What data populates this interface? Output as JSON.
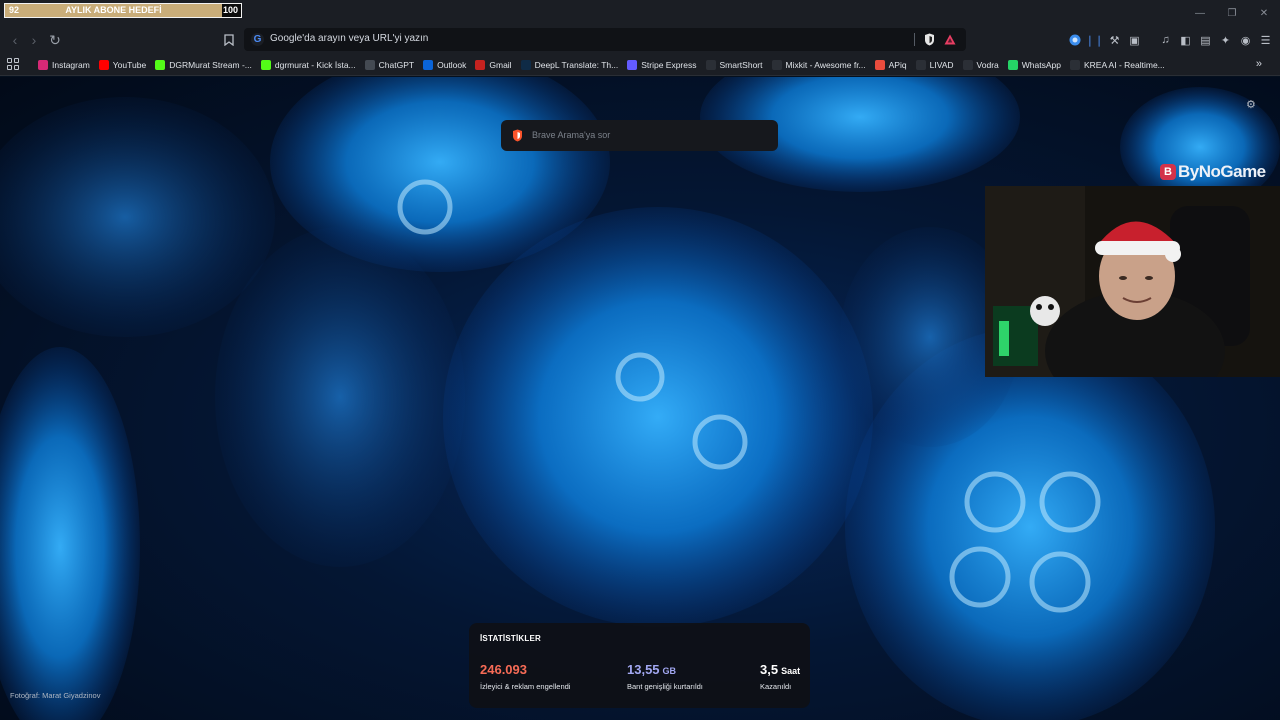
{
  "subscriber_goal": {
    "current": "92",
    "label": "AYLIK ABONE HEDEFİ",
    "target": "100",
    "progress": 0.92
  },
  "window_controls": [
    "minimize",
    "maximize",
    "close"
  ],
  "toolbar": {
    "omnibox_text": "Google'da arayın veya URL'yi yazın",
    "icons": [
      "back-icon",
      "forward-icon",
      "reload-icon",
      "bookmark-icon",
      "shield-icon",
      "rewards-icon"
    ]
  },
  "bookmarks": [
    {
      "label": "Instagram",
      "icon": "instagram-icon",
      "color": "#d62976"
    },
    {
      "label": "YouTube",
      "icon": "youtube-icon",
      "color": "#ff0000"
    },
    {
      "label": "DGRMurat Stream -...",
      "icon": "kick-icon",
      "color": "#53fc18"
    },
    {
      "label": "dgrmurat - Kick İsta...",
      "icon": "kick-icon",
      "color": "#53fc18"
    },
    {
      "label": "ChatGPT",
      "icon": "chatgpt-icon",
      "color": "#444a52"
    },
    {
      "label": "Outlook",
      "icon": "outlook-icon",
      "color": "#0a64d8"
    },
    {
      "label": "Gmail",
      "icon": "gmail-icon",
      "color": "#c5221f"
    },
    {
      "label": "DeepL Translate: Th...",
      "icon": "deepl-icon",
      "color": "#0f2b46"
    },
    {
      "label": "Stripe Express",
      "icon": "stripe-icon",
      "color": "#635bff"
    },
    {
      "label": "SmartShort",
      "icon": "smartshort-icon",
      "color": "#2b2f36"
    },
    {
      "label": "Mixkit - Awesome fr...",
      "icon": "mixkit-icon",
      "color": "#2b2f36"
    },
    {
      "label": "APiq",
      "icon": "apiq-icon",
      "color": "#e94c3d"
    },
    {
      "label": "LIVAD",
      "icon": "livad-icon",
      "color": "#2b2f36"
    },
    {
      "label": "Vodra",
      "icon": "vodra-icon",
      "color": "#2b2f36"
    },
    {
      "label": "WhatsApp",
      "icon": "whatsapp-icon",
      "color": "#25d366"
    },
    {
      "label": "KREA AI - Realtime...",
      "icon": "krea-icon",
      "color": "#2b2f36"
    }
  ],
  "newtab": {
    "search_placeholder": "Brave Arama'ya sor",
    "photo_credit": "Fotoğraf: Marat Giyadzinov",
    "stats": {
      "title": "İSTATİSTİKLER",
      "items": [
        {
          "value": "246.093",
          "unit": "",
          "desc": "İzleyici & reklam engellendi",
          "color": "#f66b56"
        },
        {
          "value": "13,55",
          "unit": "GB",
          "desc": "Bant genişliği kurtarıldı",
          "color": "#a2a8f2"
        },
        {
          "value": "3,5",
          "unit": "Saat",
          "desc": "Kazanıldı",
          "color": "#ffffff"
        }
      ]
    }
  },
  "overlay": {
    "brand": "ByNoGame",
    "webcam": "streamer-webcam"
  },
  "colors": {
    "chrome_bg": "#1b1e24",
    "goal_fill": "#c9ad79",
    "stats_bg": "#0e1016"
  }
}
